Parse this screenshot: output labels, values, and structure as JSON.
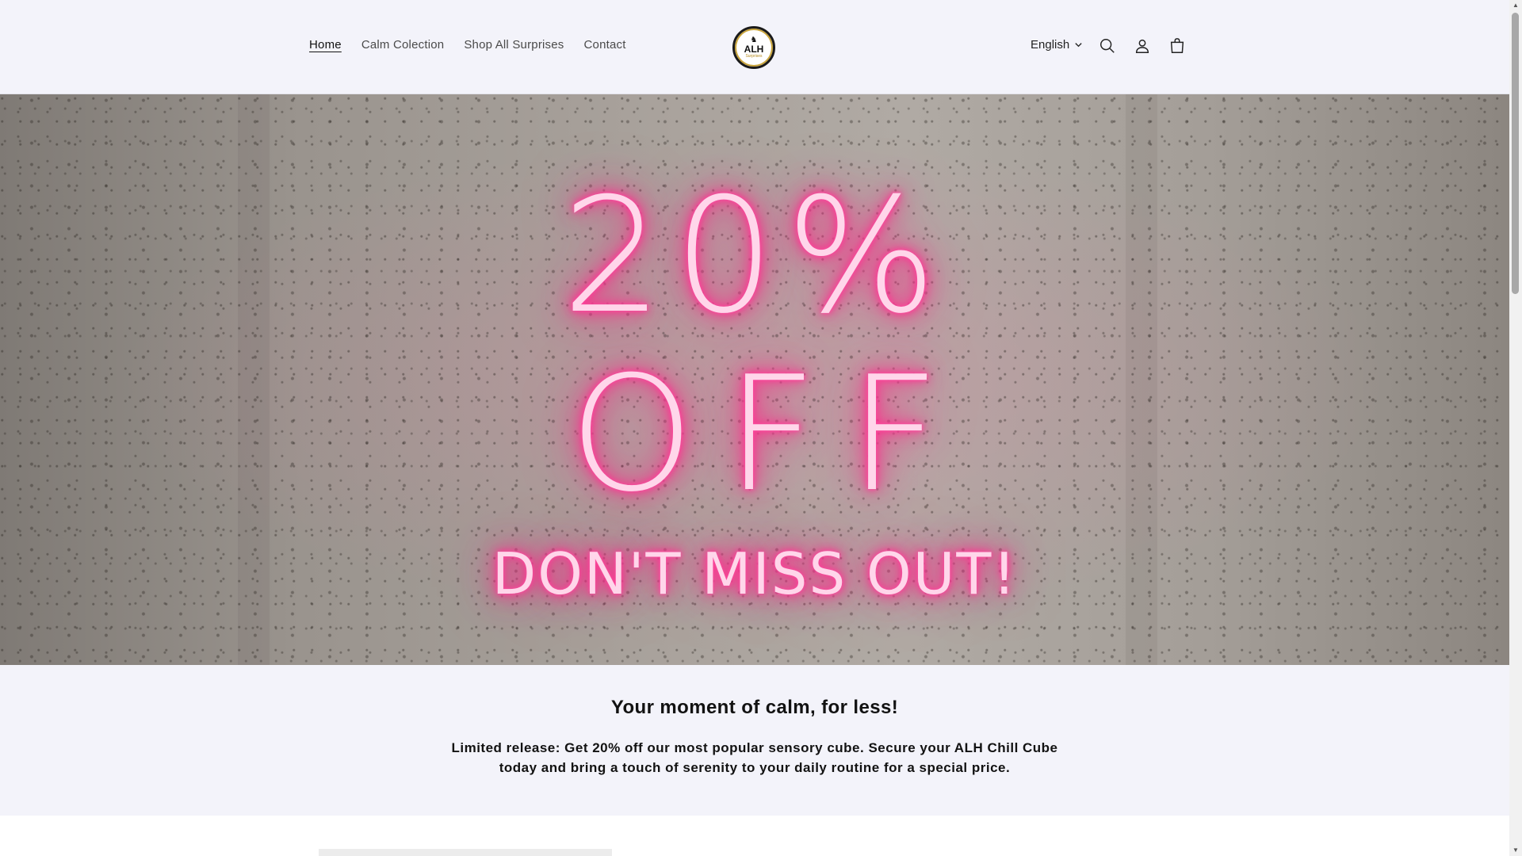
{
  "header": {
    "nav": [
      {
        "label": "Home",
        "active": true
      },
      {
        "label": "Calm Colection",
        "active": false
      },
      {
        "label": "Shop All Surprises",
        "active": false
      },
      {
        "label": "Contact",
        "active": false
      }
    ],
    "logo": {
      "text": "ALH",
      "sub": "Surprises"
    },
    "language": "English",
    "icons": [
      "search-icon",
      "account-icon",
      "cart-icon"
    ]
  },
  "hero": {
    "line1": "20%",
    "line2": "OFF",
    "line3": "DON'T MISS OUT!",
    "neon_color": "#ff2f8f"
  },
  "promo": {
    "heading": "Your moment of calm, for less!",
    "body": "Limited release: Get 20% off our most popular sensory cube. Secure your ALH Chill Cube today and bring a touch of serenity to your daily routine for a special price."
  }
}
